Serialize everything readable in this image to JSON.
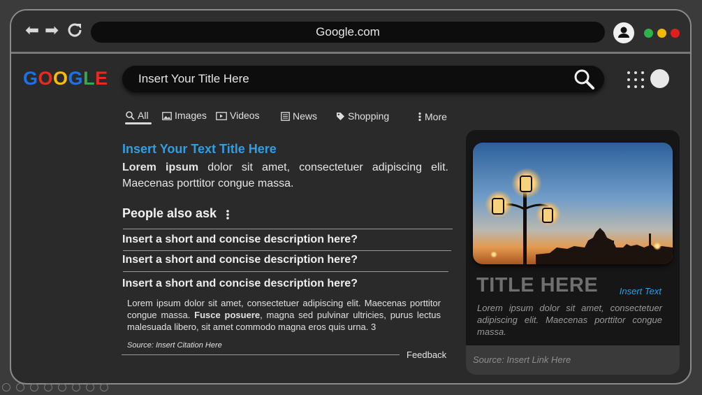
{
  "browser": {
    "url": "Google.com",
    "window_dots": [
      {
        "name": "green",
        "color": "#2fb24a"
      },
      {
        "name": "yellow",
        "color": "#f5b800"
      },
      {
        "name": "red",
        "color": "#e01e1e"
      }
    ]
  },
  "logo": {
    "letters": [
      {
        "char": "G",
        "color": "#1a73e8"
      },
      {
        "char": "O",
        "color": "#ea2a1d"
      },
      {
        "char": "O",
        "color": "#fbbc05"
      },
      {
        "char": "G",
        "color": "#1a73e8"
      },
      {
        "char": "L",
        "color": "#34a853"
      },
      {
        "char": "E",
        "color": "#ea2a1d"
      }
    ]
  },
  "search": {
    "query": "Insert Your Title Here"
  },
  "tabs": [
    {
      "label": "All",
      "icon": "search-icon"
    },
    {
      "label": "Images",
      "icon": "image-icon"
    },
    {
      "label": "Videos",
      "icon": "video-icon"
    },
    {
      "label": "News",
      "icon": "news-icon"
    },
    {
      "label": "Shopping",
      "icon": "tag-icon"
    },
    {
      "label": "More",
      "icon": "more-vertical-icon"
    }
  ],
  "result": {
    "title": "Insert Your Text Title Here",
    "bold_lead": "Lorem ipsum",
    "body": " dolor sit amet, consectetuer adipiscing elit. Maecenas porttitor congue massa."
  },
  "people_also_ask": {
    "heading": "People also ask",
    "questions": [
      "Insert a short and concise description here?",
      "Insert a short and concise description here?",
      "Insert a short and concise description here?"
    ],
    "answer_part1": "Lorem ipsum dolor sit amet, consectetuer adipiscing elit. Maecenas porttitor congue massa. ",
    "answer_bold": "Fusce posuere",
    "answer_part2": ", magna sed pulvinar ultricies, purus lectus malesuada libero, sit amet commodo magna eros quis urna. 3",
    "source": "Source: Insert Citation Here",
    "feedback": "Feedback"
  },
  "card": {
    "title": "TITLE HERE",
    "insert_text": "Insert Text",
    "description": "Lorem ipsum dolor sit amet, consectetuer adipiscing elit. Maecenas porttitor congue massa.",
    "link": "Source: Insert Link Here"
  }
}
